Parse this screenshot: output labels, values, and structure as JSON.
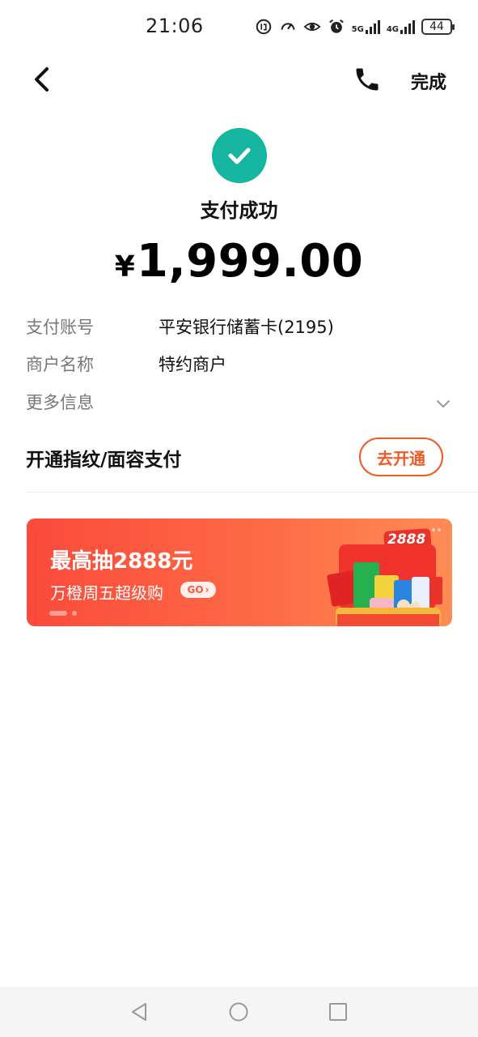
{
  "status_bar": {
    "time": "21:06",
    "icons": [
      "data-saver-icon",
      "speed-icon",
      "eye-icon",
      "alarm-icon"
    ],
    "network_1": "5G",
    "network_2": "4G",
    "battery": "44"
  },
  "header": {
    "back_icon": "chevron-left-icon",
    "call_icon": "phone-icon",
    "done_label": "完成"
  },
  "result": {
    "icon": "check-circle-icon",
    "title": "支付成功",
    "currency": "¥",
    "amount": "1,999.00",
    "accent_color": "#15b5a0"
  },
  "details": [
    {
      "label": "支付账号",
      "value": "平安银行储蓄卡(2195)"
    },
    {
      "label": "商户名称",
      "value": "特约商户"
    },
    {
      "label": "更多信息",
      "value": ""
    }
  ],
  "fingerprint": {
    "title": "开通指纹/面容支付",
    "button_label": "去开通",
    "button_color": "#f05a24"
  },
  "banner": {
    "title": "最高抽2888元",
    "subtitle": "万橙周五超级购",
    "go_label": "GO",
    "badge": "2888"
  },
  "system_nav": {
    "back": "nav-back-icon",
    "home": "nav-home-icon",
    "recents": "nav-recents-icon"
  }
}
